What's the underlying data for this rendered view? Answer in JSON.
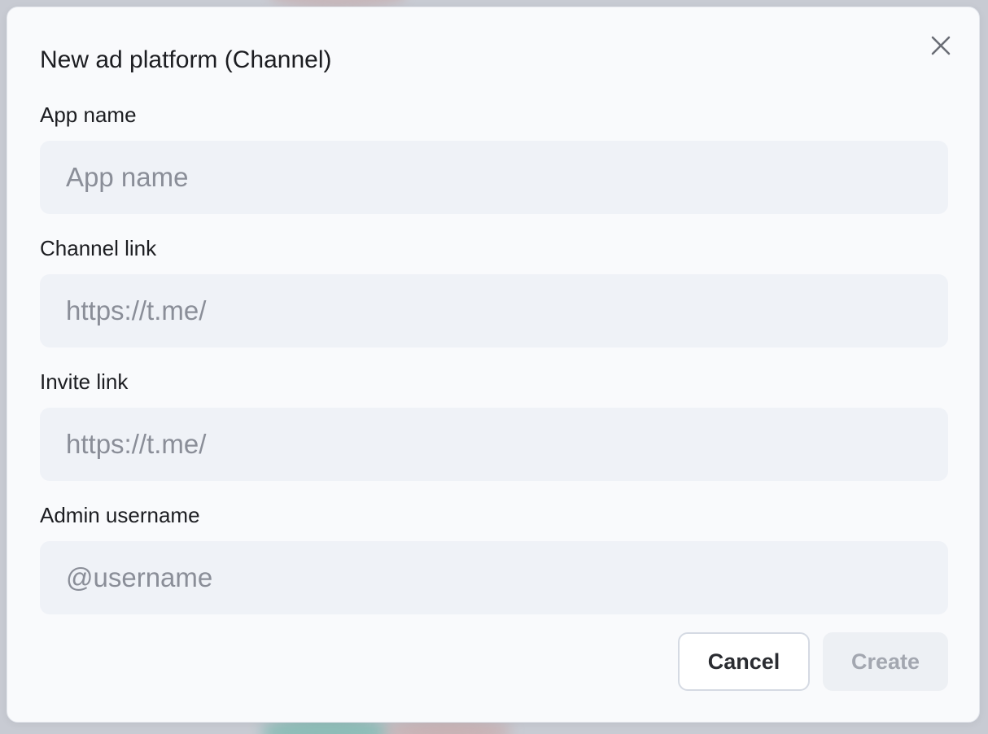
{
  "dialog": {
    "title": "New ad platform (Channel)",
    "close_icon": "close-icon"
  },
  "fields": {
    "app_name": {
      "label": "App name",
      "placeholder": "App name",
      "value": ""
    },
    "channel_link": {
      "label": "Channel link",
      "placeholder": "https://t.me/",
      "value": ""
    },
    "invite_link": {
      "label": "Invite link",
      "placeholder": "https://t.me/",
      "value": ""
    },
    "admin_username": {
      "label": "Admin username",
      "placeholder": "@username",
      "value": ""
    }
  },
  "actions": {
    "cancel_label": "Cancel",
    "create_label": "Create",
    "create_enabled": false
  },
  "colors": {
    "dialog_background": "#f9fafc",
    "input_background": "#eff2f7",
    "placeholder_text": "#8a8e98",
    "disabled_button_text": "#a3a7b0"
  }
}
